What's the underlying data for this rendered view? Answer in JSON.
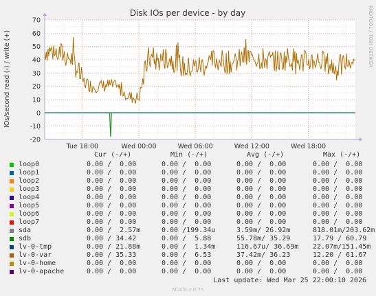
{
  "chart_data": {
    "type": "line",
    "title": "Disk IOs per device - by day",
    "ylabel": "IOs/second read (-) / write (+)",
    "watermark": "RRDTOOL / TOBI OETIKER",
    "ylim": [
      -20,
      70
    ],
    "y_ticks": [
      "-20",
      "-10",
      "0",
      "10",
      "20",
      "30",
      "40",
      "50",
      "60",
      "70"
    ],
    "x_ticks": [
      "Tue 18:00",
      "Wed 00:00",
      "Wed 06:00",
      "Wed 12:00",
      "Wed 18:00"
    ],
    "grid": true,
    "series": [
      {
        "name": "lv-0-var",
        "color": "#b06d00",
        "style": "spiky",
        "x_hours": [
          0,
          1,
          2,
          3,
          4,
          5,
          6,
          7,
          8,
          9,
          10,
          11,
          12,
          13,
          14,
          15,
          16,
          17,
          18,
          19,
          20,
          21,
          22,
          23,
          24,
          25,
          26,
          27,
          28,
          29,
          30,
          31,
          32,
          33
        ],
        "values": [
          47,
          46,
          44,
          40,
          24,
          20,
          20,
          21,
          18,
          12,
          11,
          41,
          39,
          42,
          38,
          33,
          35,
          36,
          40,
          39,
          37,
          41,
          42,
          41,
          39,
          39,
          42,
          38,
          39,
          40,
          37,
          33,
          38,
          38
        ]
      },
      {
        "name": "sdb",
        "color": "#1e8c28",
        "style": "dip",
        "x_hours": [
          0,
          6.9,
          7,
          7.1,
          33
        ],
        "values": [
          0,
          0,
          -18,
          0,
          0
        ]
      },
      {
        "name": "lv-0-tmp",
        "color": "#006060",
        "style": "flat",
        "x_hours": [
          0,
          33
        ],
        "values": [
          0,
          0
        ]
      }
    ]
  },
  "legend": {
    "headers": {
      "cur": "Cur (-/+)",
      "min": "Min (-/+)",
      "avg": "Avg (-/+)",
      "max": "Max (-/+)"
    },
    "rows": [
      {
        "name": "loop0",
        "color": "#00cc00",
        "cur": "0.00 /  0.00",
        "min": "0.00 /  0.00",
        "avg": "0.00 /  0.00",
        "max": "0.00 /  0.00"
      },
      {
        "name": "loop1",
        "color": "#0066b3",
        "cur": "0.00 /  0.00",
        "min": "0.00 /  0.00",
        "avg": "0.00 /  0.00",
        "max": "0.00 /  0.00"
      },
      {
        "name": "loop2",
        "color": "#ff8000",
        "cur": "0.00 /  0.00",
        "min": "0.00 /  0.00",
        "avg": "0.00 /  0.00",
        "max": "0.00 /  0.00"
      },
      {
        "name": "loop3",
        "color": "#ffcc00",
        "cur": "0.00 /  0.00",
        "min": "0.00 /  0.00",
        "avg": "0.00 /  0.00",
        "max": "0.00 /  0.00"
      },
      {
        "name": "loop4",
        "color": "#330099",
        "cur": "0.00 /  0.00",
        "min": "0.00 /  0.00",
        "avg": "0.00 /  0.00",
        "max": "0.00 /  0.00"
      },
      {
        "name": "loop5",
        "color": "#990099",
        "cur": "0.00 /  0.00",
        "min": "0.00 /  0.00",
        "avg": "0.00 /  0.00",
        "max": "0.00 /  0.00"
      },
      {
        "name": "loop6",
        "color": "#ccff00",
        "cur": "0.00 /  0.00",
        "min": "0.00 /  0.00",
        "avg": "0.00 /  0.00",
        "max": "0.00 /  0.00"
      },
      {
        "name": "loop7",
        "color": "#ff0000",
        "cur": "0.00 /  0.00",
        "min": "0.00 /  0.00",
        "avg": "0.00 /  0.00",
        "max": "0.00 /  0.00"
      },
      {
        "name": "sda",
        "color": "#808080",
        "cur": "0.00 /  2.57m",
        "min": "0.00 /199.34u",
        "avg": "3.59m/ 26.92m",
        "max": "818.01m/203.62m"
      },
      {
        "name": "sdb",
        "color": "#008f00",
        "cur": "0.00 / 34.42",
        "min": "0.00 /  5.88",
        "avg": "55.78m/ 35.29",
        "max": "17.79 / 60.79"
      },
      {
        "name": "lv-0-tmp",
        "color": "#00487d",
        "cur": "0.00 / 21.88m",
        "min": "0.00 /  1.34m",
        "avg": "116.67u/ 36.69m",
        "max": "22.07m/151.45m"
      },
      {
        "name": "lv-0-var",
        "color": "#b35a00",
        "cur": "0.00 / 35.33",
        "min": "0.00 /  6.53",
        "avg": "37.42m/ 36.23",
        "max": "12.20 / 61.67"
      },
      {
        "name": "lv-0-home",
        "color": "#b38f00",
        "cur": "0.00 /  0.00",
        "min": "0.00 /  0.00",
        "avg": "0.00 /  0.00",
        "max": "0.00 /  0.00"
      },
      {
        "name": "lv-0-apache",
        "color": "#6b006b",
        "cur": "0.00 /  0.00",
        "min": "0.00 /  0.00",
        "avg": "0.00 /  0.00",
        "max": "0.00 /  0.00"
      }
    ]
  },
  "footer": {
    "last_update": "Last update: Wed Mar 25 22:00:10 2026",
    "version": "Munin 2.0.75"
  }
}
